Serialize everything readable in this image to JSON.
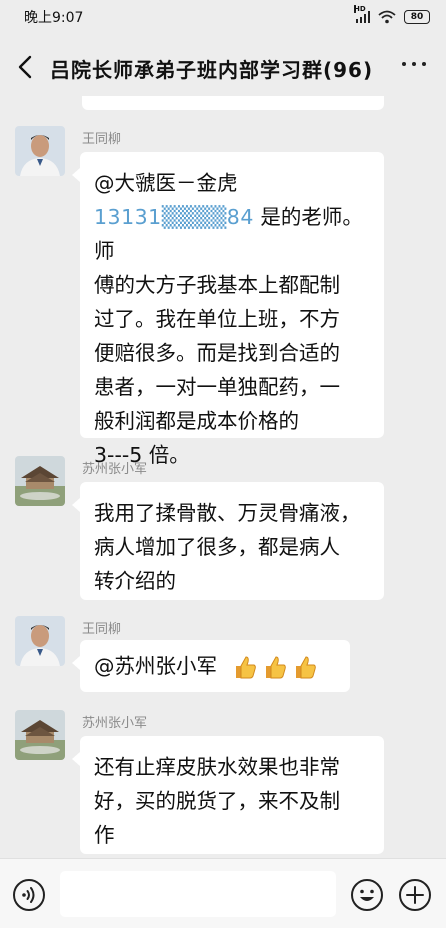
{
  "status_bar": {
    "time": "晚上9:07",
    "signal_label": "HD",
    "battery": "80"
  },
  "header": {
    "title": "吕院长师承弟子班内部学习群(96)"
  },
  "messages": [
    {
      "sender": "王同柳",
      "lines": [
        "@大虢医－金虎",
        "是的老师。师",
        "傅的大方子我基本上都配制",
        "过了。我在单位上班，不方",
        "便赔很多。而是找到合适的",
        "患者，一对一单独配药，一",
        "般利润都是成本价格的",
        "3---5 倍。"
      ],
      "phone": "13131▒▒▒▒84"
    },
    {
      "sender": "苏州张小军",
      "lines": [
        "我用了揉骨散、万灵骨痛液，",
        "病人增加了很多，都是病人",
        "转介绍的"
      ]
    },
    {
      "sender": "王同柳",
      "lines": [
        "@苏州张小军"
      ]
    },
    {
      "sender": "苏州张小军",
      "lines": [
        "还有止痒皮肤水效果也非常",
        "好，买的脱货了，来不及制",
        "作"
      ]
    }
  ],
  "input": {
    "placeholder": "",
    "value": ""
  },
  "icons": {
    "back": "chevron-left-icon",
    "more": "more-dots-icon",
    "voice": "voice-icon",
    "emoji": "emoji-icon",
    "plus": "plus-icon",
    "thumbs": "thumbs-up-icon"
  }
}
